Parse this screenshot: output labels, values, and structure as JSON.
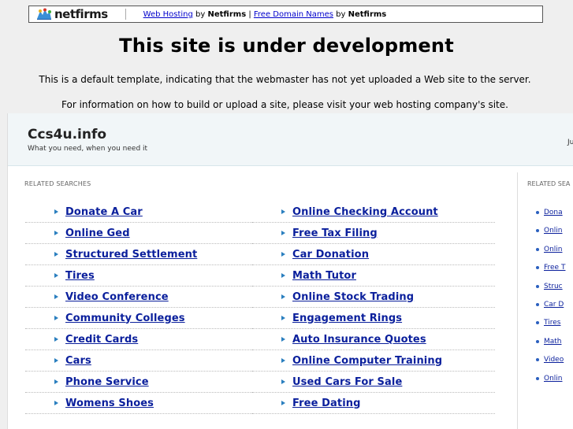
{
  "netfirms_bar": {
    "logo_text": "netfirms",
    "link1": "Web Hosting",
    "by1": " by ",
    "brand1": "Netfirms",
    "separator": " | ",
    "link2": "Free Domain Names",
    "by2": " by ",
    "brand2": "Netfirms"
  },
  "notice": {
    "headline": "This site is under development",
    "line1": "This is a default template, indicating that the webmaster has not yet uploaded a Web site to the server.",
    "line2": "For information on how to build or upload a site, please visit your web hosting company's site."
  },
  "parked": {
    "title": "Ccs4u.info",
    "tagline": "What you need, when you need it",
    "header_cut": "Ju",
    "related_label": "RELATED SEARCHES",
    "related_label_right": "RELATED SEA",
    "left_links": [
      "Donate A Car",
      "Online Ged",
      "Structured Settlement",
      "Tires",
      "Video Conference",
      "Community Colleges",
      "Credit Cards",
      "Cars",
      "Phone Service",
      "Womens Shoes"
    ],
    "mid_links": [
      "Online Checking Account",
      "Free Tax Filing",
      "Car Donation",
      "Math Tutor",
      "Online Stock Trading",
      "Engagement Rings",
      "Auto Insurance Quotes",
      "Online Computer Training",
      "Used Cars For Sale",
      "Free Dating"
    ],
    "side_links": [
      "Dona",
      "Onlin",
      "Onlin",
      "Free T",
      "Struc",
      "Car D",
      "Tires",
      "Math",
      "Video",
      "Onlin"
    ]
  },
  "colors": {
    "link": "#0a1f9c",
    "arrow": "#2a7fbf",
    "header_bg": "#f1f6f8",
    "page_bg": "#efefef"
  }
}
